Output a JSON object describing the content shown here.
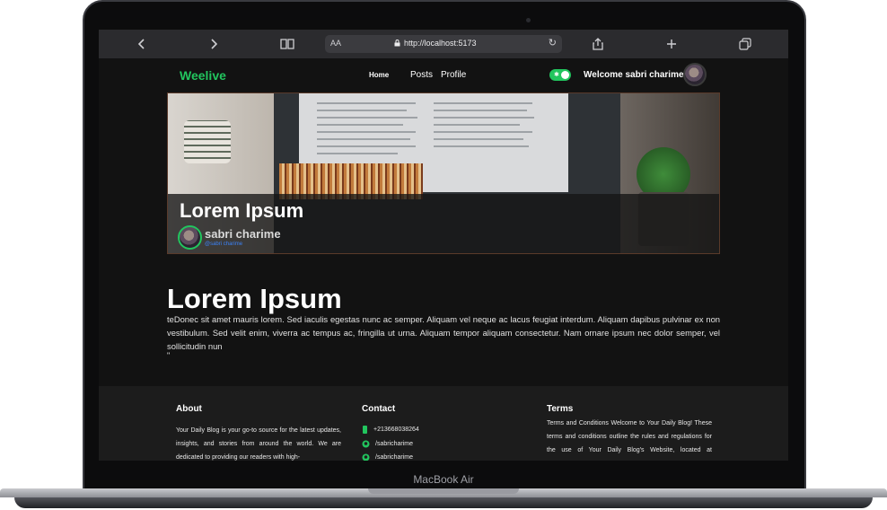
{
  "device": {
    "model": "MacBook Air"
  },
  "browser": {
    "url": "http://localhost:5173",
    "aa_label": "AA",
    "icons": [
      "back-icon",
      "forward-icon",
      "bookmarks-icon",
      "lock-icon",
      "reload-icon",
      "share-icon",
      "new-tab-icon",
      "tabs-icon"
    ]
  },
  "navbar": {
    "logo": "Weelive",
    "links": [
      "Home",
      "Posts",
      "Profile"
    ],
    "theme_toggle": {
      "on": true
    },
    "welcome": "Welcome sabri charime"
  },
  "hero": {
    "title": "Lorem Ipsum",
    "author_name": "sabri charime",
    "author_handle": "@sabri charime"
  },
  "article": {
    "title": "Lorem Ipsum",
    "body": "teDonec sit amet mauris lorem. Sed iaculis egestas nunc ac semper. Aliquam vel neque ac lacus feugiat interdum. Aliquam dapibus pulvinar ex non vestibulum. Sed velit enim, viverra ac tempus ac, fringilla ut urna. Aliquam tempor aliquam consectetur. Nam ornare ipsum nec dolor semper, vel sollicitudin nun",
    "tail": "\""
  },
  "footer": {
    "about": {
      "heading": "About",
      "text": "Your Daily Blog is your go-to source for the latest updates, insights, and stories from around the world. We are dedicated to providing our readers with high-"
    },
    "contact": {
      "heading": "Contact",
      "items": [
        {
          "icon": "phone-icon",
          "text": "+213668038264"
        },
        {
          "icon": "github-icon",
          "text": "/sabricharime"
        },
        {
          "icon": "github-icon",
          "text": "/sabricharime"
        }
      ]
    },
    "terms": {
      "heading": "Terms",
      "text": "Terms and Conditions Welcome to Your Daily Blog! These terms and conditions outline the rules and regulations for the use of Your Daily Blog's Website, located at www.yourdailyblog.com. By accessing this"
    }
  },
  "colors": {
    "accent": "#22c55e",
    "background": "#121212",
    "footer": "#1c1c1c",
    "handle": "#3b82f6"
  }
}
